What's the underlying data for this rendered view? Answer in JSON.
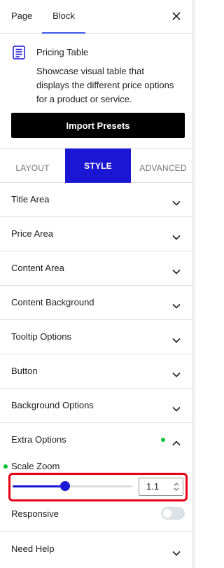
{
  "header": {
    "tabs": [
      {
        "label": "Page"
      },
      {
        "label": "Block"
      }
    ]
  },
  "block": {
    "title": "Pricing Table",
    "description": "Showcase visual table that displays the different price options for a product or service.",
    "import_label": "Import Presets"
  },
  "style_tabs": [
    {
      "label": "LAYOUT"
    },
    {
      "label": "STYLE"
    },
    {
      "label": "ADVANCED"
    }
  ],
  "sections": [
    {
      "label": "Title Area"
    },
    {
      "label": "Price Area"
    },
    {
      "label": "Content Area"
    },
    {
      "label": "Content Background"
    },
    {
      "label": "Tooltip Options"
    },
    {
      "label": "Button"
    },
    {
      "label": "Background Options"
    },
    {
      "label": "Extra Options"
    }
  ],
  "extra_options": {
    "scale_zoom_label": "Scale Zoom",
    "scale_zoom_value": "1.1",
    "scale_zoom_fraction": 0.44,
    "responsive_label": "Responsive",
    "responsive_enabled": false
  },
  "help": {
    "label": "Need Help"
  },
  "colors": {
    "accent": "#1b16d4",
    "active_tab_underline": "#3858e9",
    "status_dot": "#00c030",
    "highlight_border": "#e60012",
    "button_bg": "#000000"
  },
  "icons": {
    "close": "close-icon",
    "block": "pricing-table-icon",
    "chevron_down": "chevron-down-icon",
    "chevron_up": "chevron-up-icon",
    "spinner": "spinner-arrows-icon"
  }
}
